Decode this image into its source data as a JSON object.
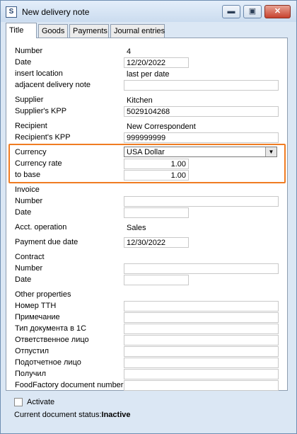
{
  "window": {
    "title": "New delivery note",
    "icon": "document-app-icon",
    "buttons": {
      "minimize": "▬",
      "maximize": "▣",
      "close": "✕"
    }
  },
  "tabs": [
    {
      "label": "Title",
      "active": true
    },
    {
      "label": "Goods"
    },
    {
      "label": "Payments"
    },
    {
      "label": "Journal entries"
    }
  ],
  "form": {
    "number": {
      "label": "Number",
      "value": "4"
    },
    "date": {
      "label": "Date",
      "value": "12/20/2022"
    },
    "insert_location": {
      "label": "insert location",
      "value": "last per date"
    },
    "adjacent": {
      "label": "adjacent delivery note",
      "value": ""
    },
    "supplier": {
      "label": "Supplier",
      "value": "Kitchen"
    },
    "supplier_kpp": {
      "label": "Supplier's KPP",
      "value": "5029104268"
    },
    "recipient": {
      "label": "Recipient",
      "value": "New Correspondent"
    },
    "recipient_kpp": {
      "label": "Recipient's KPP",
      "value": "999999999"
    },
    "currency": {
      "label": "Currency",
      "value": "USA Dollar"
    },
    "currency_rate": {
      "label": "Currency rate",
      "value": "1.00"
    },
    "to_base": {
      "label": "to base",
      "value": "1.00"
    },
    "invoice": {
      "heading": "Invoice",
      "number_label": "Number",
      "number": "",
      "date_label": "Date",
      "date": ""
    },
    "acct_operation": {
      "label": "Acct. operation",
      "value": "Sales"
    },
    "payment_due": {
      "label": "Payment due date",
      "value": "12/30/2022"
    },
    "contract": {
      "heading": "Contract",
      "number_label": "Number",
      "number": "",
      "date_label": "Date",
      "date": ""
    },
    "other": {
      "heading": "Other properties",
      "fields": [
        {
          "label": "Номер ТТН",
          "value": ""
        },
        {
          "label": "Примечание",
          "value": ""
        },
        {
          "label": "Тип документа в 1С",
          "value": ""
        },
        {
          "label": "Ответственное лицо",
          "value": ""
        },
        {
          "label": "Отпустил",
          "value": ""
        },
        {
          "label": "Подотчетное лицо",
          "value": ""
        },
        {
          "label": "Получил",
          "value": ""
        },
        {
          "label": "FoodFactory document number",
          "value": ""
        }
      ]
    }
  },
  "bottom": {
    "activate_label": "Activate",
    "activate_checked": false,
    "status_label": "Current document status:",
    "status_value": "Inactive"
  },
  "colors": {
    "highlight": "#f07c22",
    "title_bar": "#cbdcef"
  }
}
